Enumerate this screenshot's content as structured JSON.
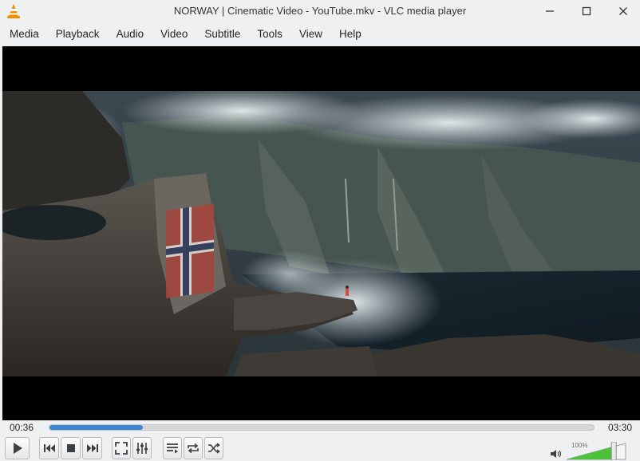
{
  "window": {
    "title": "NORWAY | Cinematic Video - YouTube.mkv - VLC media player",
    "logo_icon": "vlc-cone-icon",
    "minimize_icon": "minimize-icon",
    "maximize_icon": "maximize-icon",
    "close_icon": "close-icon"
  },
  "menu": {
    "items": [
      "Media",
      "Playback",
      "Audio",
      "Video",
      "Subtitle",
      "Tools",
      "View",
      "Help"
    ]
  },
  "video": {
    "content": "Cliff edge over a fjord with a Norwegian flag painted on a rock"
  },
  "seek": {
    "elapsed": "00:36",
    "total": "03:30",
    "progress_fraction": 0.171
  },
  "controls": {
    "icons": {
      "play": "play-icon",
      "previous": "skip-previous-icon",
      "stop": "stop-icon",
      "next": "skip-next-icon",
      "fullscreen": "fullscreen-icon",
      "extended_settings": "equalizer-icon",
      "playlist": "playlist-icon",
      "loop": "loop-icon",
      "random": "shuffle-icon",
      "volume": "speaker-icon"
    }
  },
  "volume": {
    "label": "100%",
    "level_fraction": 0.8
  },
  "colors": {
    "accent": "#3a86d0",
    "volume_green": "#4ec13a",
    "title_bar": "#eff0f1",
    "video_background": "#000000",
    "vlc_orange": "#f48b00"
  }
}
